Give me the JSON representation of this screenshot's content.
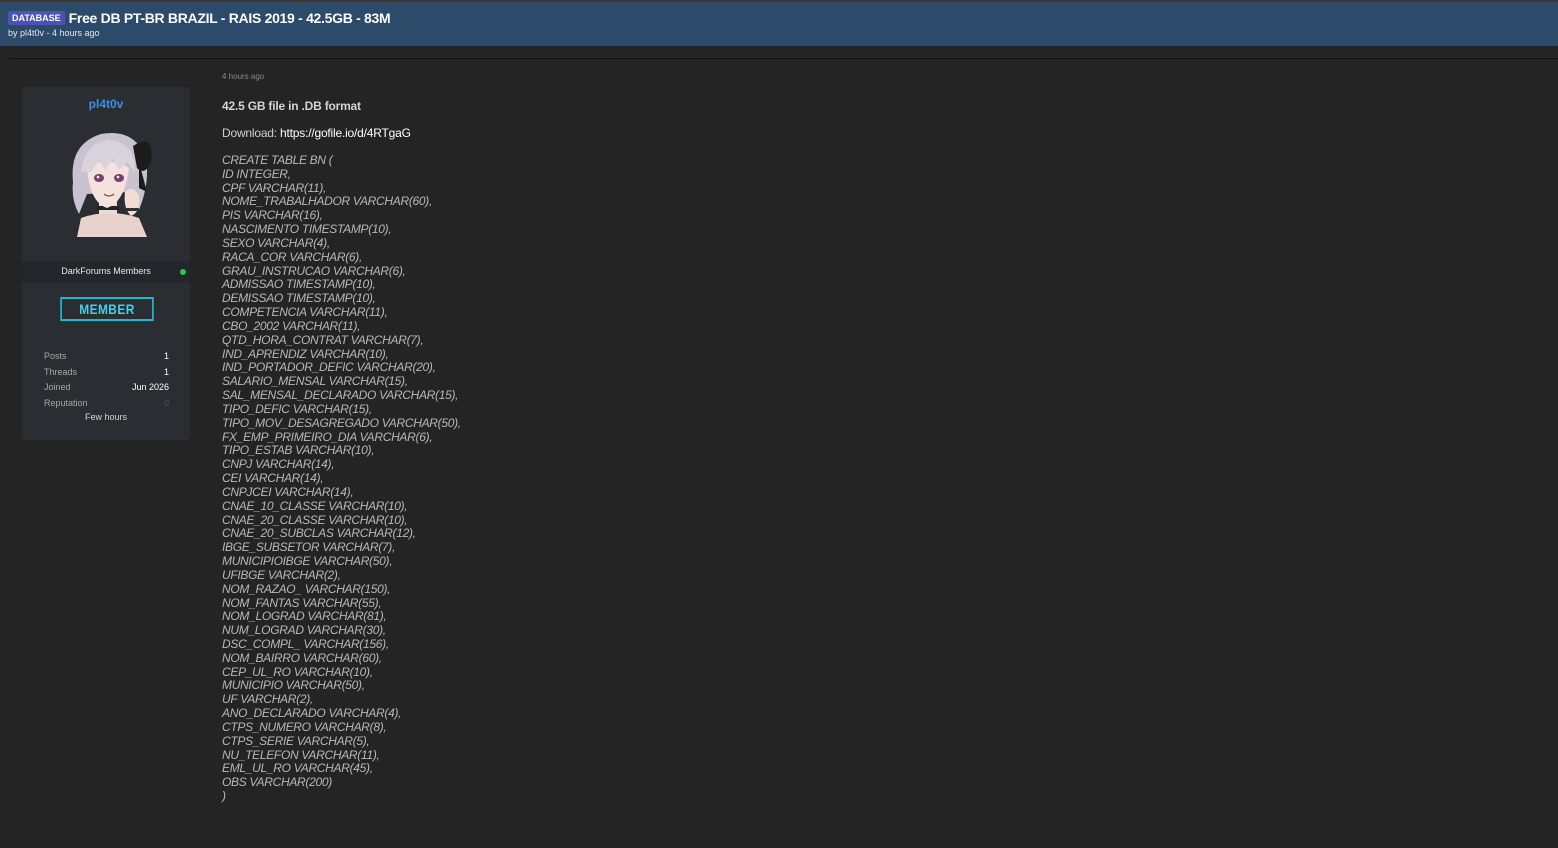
{
  "thread": {
    "prefix": "DATABASE",
    "title": "Free DB PT-BR BRAZIL - RAIS 2019 - 42.5GB - 83M",
    "meta": "by pl4t0v - 4 hours ago"
  },
  "user": {
    "name": "pl4t0v",
    "group": "DarkForums Members",
    "badge": "MEMBER",
    "stats": [
      {
        "label": "Posts",
        "value": "1"
      },
      {
        "label": "Threads",
        "value": "1"
      },
      {
        "label": "Joined",
        "value": "Jun 2026"
      },
      {
        "label": "Reputation",
        "value": "0"
      }
    ],
    "last_active": "Few hours"
  },
  "post": {
    "time": "4 hours ago",
    "headline": "42.5 GB file in .DB format",
    "download_label": "Download:",
    "download_url": "https://gofile.io/d/4RTgaG",
    "sql_lines": [
      "CREATE TABLE BN (",
      "ID INTEGER,",
      "CPF VARCHAR(11),",
      "NOME_TRABALHADOR VARCHAR(60),",
      "PIS VARCHAR(16),",
      "NASCIMENTO TIMESTAMP(10),",
      "SEXO VARCHAR(4),",
      "RACA_COR VARCHAR(6),",
      "GRAU_INSTRUCAO VARCHAR(6),",
      "ADMISSAO TIMESTAMP(10),",
      "DEMISSAO TIMESTAMP(10),",
      "COMPETENCIA VARCHAR(11),",
      "CBO_2002 VARCHAR(11),",
      "QTD_HORA_CONTRAT VARCHAR(7),",
      "IND_APRENDIZ VARCHAR(10),",
      "IND_PORTADOR_DEFIC VARCHAR(20),",
      "SALARIO_MENSAL VARCHAR(15),",
      "SAL_MENSAL_DECLARADO VARCHAR(15),",
      "TIPO_DEFIC VARCHAR(15),",
      "TIPO_MOV_DESAGREGADO VARCHAR(50),",
      "FX_EMP_PRIMEIRO_DIA VARCHAR(6),",
      "TIPO_ESTAB VARCHAR(10),",
      "CNPJ VARCHAR(14),",
      "CEI VARCHAR(14),",
      "CNPJCEI VARCHAR(14),",
      "CNAE_10_CLASSE VARCHAR(10),",
      "CNAE_20_CLASSE VARCHAR(10),",
      "CNAE_20_SUBCLAS VARCHAR(12),",
      "IBGE_SUBSETOR VARCHAR(7),",
      "MUNICIPIOIBGE VARCHAR(50),",
      "UFIBGE VARCHAR(2),",
      "NOM_RAZAO_ VARCHAR(150),",
      "NOM_FANTAS VARCHAR(55),",
      "NOM_LOGRAD VARCHAR(81),",
      "NUM_LOGRAD VARCHAR(30),",
      "DSC_COMPL_ VARCHAR(156),",
      "NOM_BAIRRO VARCHAR(60),",
      "CEP_UL_RO VARCHAR(10),",
      "MUNICIPIO VARCHAR(50),",
      "UF VARCHAR(2),",
      "ANO_DECLARADO VARCHAR(4),",
      "CTPS_NUMERO VARCHAR(8),",
      "CTPS_SERIE VARCHAR(5),",
      "NU_TELEFON VARCHAR(11),",
      "EML_UL_RO VARCHAR(45),",
      "OBS VARCHAR(200)",
      ")"
    ]
  },
  "colors": {
    "header_bg": "#2c4a6a",
    "page_bg": "#242424",
    "card_bg": "#2a2d31",
    "username": "#3d8ef2",
    "badge_border": "#1fb8d0",
    "prefix_bg": "#4b52b8",
    "online": "#2ecc40"
  },
  "icons": {
    "avatar": "anime-girl-avatar",
    "status": "online-dot-icon"
  }
}
